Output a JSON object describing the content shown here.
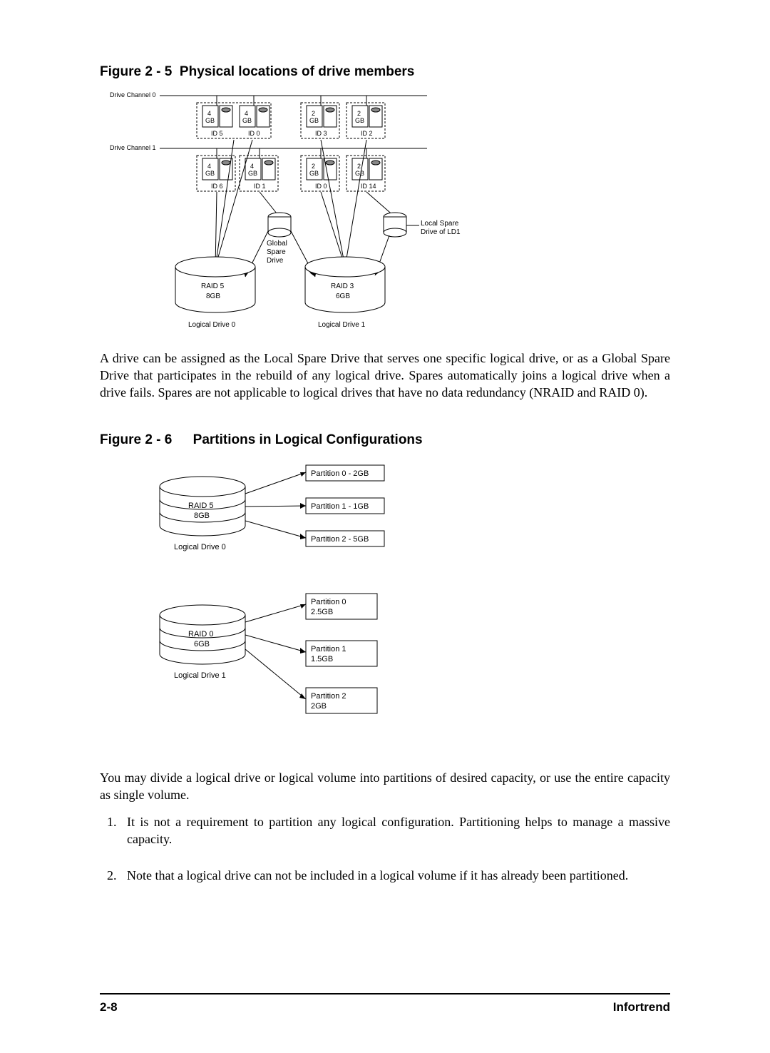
{
  "figure1": {
    "caption_prefix": "Figure 2 - 5",
    "caption_title": "Physical locations of drive members",
    "channel0": "Drive Channel 0",
    "channel1": "Drive Channel 1",
    "drives_ch0": [
      {
        "size": "4",
        "unit": "GB",
        "id": "ID 5"
      },
      {
        "size": "4",
        "unit": "GB",
        "id": "ID 0"
      },
      {
        "size": "2",
        "unit": "GB",
        "id": "ID 3"
      },
      {
        "size": "2",
        "unit": "GB",
        "id": "ID 2"
      }
    ],
    "drives_ch1": [
      {
        "size": "4",
        "unit": "GB",
        "id": "ID 6"
      },
      {
        "size": "4",
        "unit": "GB",
        "id": "ID 1"
      },
      {
        "size": "2",
        "unit": "GB",
        "id": "ID 0"
      },
      {
        "size": "2",
        "unit": "GB",
        "id": "ID 14"
      }
    ],
    "global_spare": "Global\nSpare\nDrive",
    "local_spare": "Local Spare\nDrive of LD1",
    "ld0": {
      "type": "RAID 5",
      "size": "8GB",
      "label": "Logical Drive 0"
    },
    "ld1": {
      "type": "RAID 3",
      "size": "6GB",
      "label": "Logical Drive 1"
    }
  },
  "para1": "A drive can be assigned as the Local Spare Drive that serves one specific logical drive, or as a Global Spare Drive that participates in the rebuild of any logical drive.  Spares automatically joins a logical drive when a drive fails.  Spares are not applicable to logical drives that have no data redundancy (NRAID and RAID 0).",
  "figure2": {
    "caption_prefix": "Figure 2 - 6",
    "caption_title": "Partitions in Logical Configurations",
    "ld0": {
      "type": "RAID 5",
      "size": "8GB",
      "label": "Logical Drive 0",
      "parts": [
        "Partition 0 - 2GB",
        "Partition 1 - 1GB",
        "Partition 2 - 5GB"
      ]
    },
    "ld1": {
      "type": "RAID 0",
      "size": "6GB",
      "label": "Logical Drive 1",
      "parts": [
        "Partition 0\n2.5GB",
        "Partition 1\n1.5GB",
        "Partition 2\n2GB"
      ]
    }
  },
  "para2": "You may divide a logical drive or logical volume into partitions of desired capacity, or use the entire capacity as single volume.",
  "list": [
    "It is not a requirement to partition any logical configuration. Partitioning helps to manage a massive capacity.",
    "Note that a logical drive can not be included in a logical volume if it has already been partitioned."
  ],
  "footer": {
    "page": "2-8",
    "brand": "Infortrend"
  }
}
